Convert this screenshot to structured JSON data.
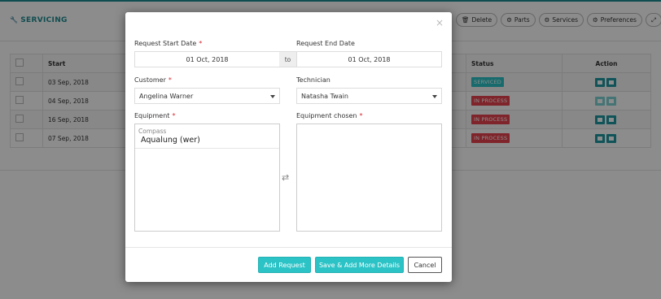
{
  "page": {
    "title": "SERVICING",
    "toolbar": [
      {
        "icon": "trash-icon",
        "label": "Delete"
      },
      {
        "icon": "gears-icon",
        "label": "Parts"
      },
      {
        "icon": "gears-icon",
        "label": "Services"
      },
      {
        "icon": "gears-icon",
        "label": "Preferences"
      }
    ],
    "table": {
      "headers": [
        "",
        "Start",
        "Status",
        "Action"
      ],
      "rows": [
        {
          "start": "03 Sep, 2018",
          "status": "SERVICED"
        },
        {
          "start": "04 Sep, 2018",
          "status": "IN PROCESS"
        },
        {
          "start": "16 Sep, 2018",
          "status": "IN PROCESS"
        },
        {
          "start": "07 Sep, 2018",
          "status": "IN PROCESS"
        }
      ]
    }
  },
  "modal": {
    "close": "×",
    "start_date": {
      "label": "Request Start Date",
      "required": "*",
      "value": "01 Oct, 2018"
    },
    "to": "to",
    "end_date": {
      "label": "Request End Date",
      "value": "01 Oct, 2018"
    },
    "customer": {
      "label": "Customer",
      "required": "*",
      "value": "Angelina Warner"
    },
    "technician": {
      "label": "Technician",
      "value": "Natasha Twain"
    },
    "equipment": {
      "label": "Equipment",
      "required": "*",
      "group": "Compass",
      "items": [
        "Aqualung (wer)"
      ]
    },
    "equipment_chosen": {
      "label": "Equipment chosen",
      "required": "*"
    },
    "swap": "⇄",
    "buttons": {
      "add": "Add Request",
      "save_more": "Save & Add More Details",
      "cancel": "Cancel"
    }
  },
  "colors": {
    "accent": "#2cc3c6",
    "brand": "#1e8c93",
    "danger": "#e8434d"
  }
}
